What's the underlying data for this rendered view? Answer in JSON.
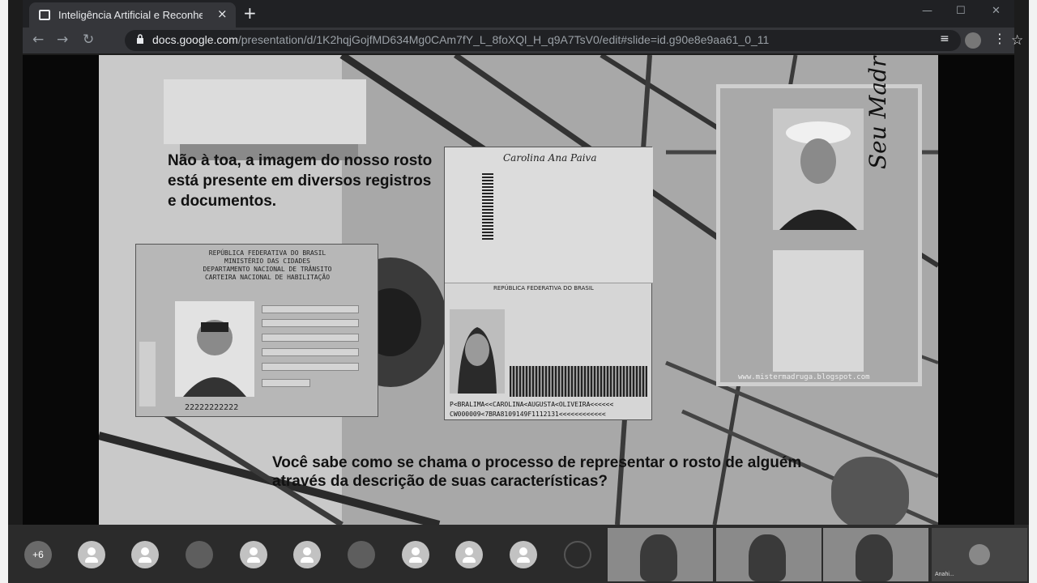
{
  "browser": {
    "tab_title": "Inteligência Artificial e Reconhecim",
    "new_tab_icon": "+",
    "close_icon": "×",
    "url_host": "docs.google.com",
    "url_path": "/presentation/d/1K2hqjGojfMD634Mg0CAm7fY_L_8foXQl_H_q9A7TsV0/edit#slide=id.g90e8e9aa61_0_11"
  },
  "slide": {
    "text_top": "Não à toa, a  imagem do nosso rosto está presente em diversos registros e documentos.",
    "text_bottom": "Você sabe como se chama o processo de representar o rosto de alguém através da descrição de suas características?",
    "cnh": {
      "header_line1": "REPÚBLICA FEDERATIVA DO BRASIL",
      "header_line2": "MINISTÉRIO DAS CIDADES",
      "header_line3": "DEPARTAMENTO NACIONAL DE TRÂNSITO",
      "header_line4": "CARTEIRA NACIONAL DE HABILITAÇÃO",
      "number": "22222222222"
    },
    "passport": {
      "signature": "Carolina Ana Paiva",
      "header": "REPÚBLICA FEDERATIVA DO BRASIL",
      "mrz_line1": "P<BRALIMA<<CAROLINA<AUGUSTA<OLIVEIRA<<<<<<",
      "mrz_line2": "CW000009<7BRA8109149F1112131<<<<<<<<<<<<"
    },
    "id_mexico": {
      "website": "www.mistermadruga.blogspot.com",
      "signature": "Seu Madruga"
    }
  },
  "participants": {
    "more_count": "+6",
    "self_label": "Anahi..."
  }
}
